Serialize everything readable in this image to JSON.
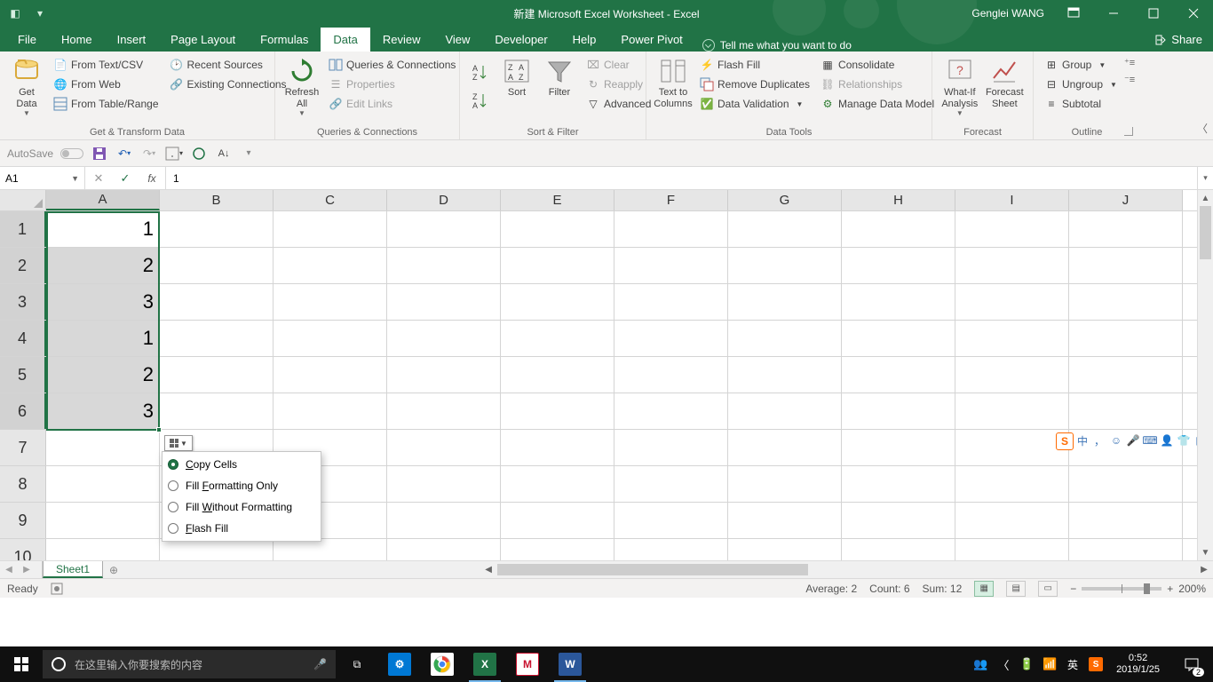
{
  "title": "新建 Microsoft Excel Worksheet  -  Excel",
  "user": "Genglei WANG",
  "tabs": [
    "File",
    "Home",
    "Insert",
    "Page Layout",
    "Formulas",
    "Data",
    "Review",
    "View",
    "Developer",
    "Help",
    "Power Pivot"
  ],
  "active_tab": "Data",
  "tellme": "Tell me what you want to do",
  "share": "Share",
  "ribbon": {
    "get_data": "Get\nData",
    "from_text": "From Text/CSV",
    "from_web": "From Web",
    "from_table": "From Table/Range",
    "recent": "Recent Sources",
    "existing": "Existing Connections",
    "g1": "Get & Transform Data",
    "refresh": "Refresh\nAll",
    "qc": "Queries & Connections",
    "props": "Properties",
    "edit_links": "Edit Links",
    "g2": "Queries & Connections",
    "sort": "Sort",
    "filter": "Filter",
    "clear": "Clear",
    "reapply": "Reapply",
    "advanced": "Advanced",
    "g3": "Sort & Filter",
    "ttc": "Text to\nColumns",
    "flash": "Flash Fill",
    "dup": "Remove Duplicates",
    "dvalid": "Data Validation",
    "consol": "Consolidate",
    "relat": "Relationships",
    "mdm": "Manage Data Model",
    "g4": "Data Tools",
    "whatif": "What-If\nAnalysis",
    "fsheet": "Forecast\nSheet",
    "g5": "Forecast",
    "group": "Group",
    "ungroup": "Ungroup",
    "subtotal": "Subtotal",
    "g6": "Outline"
  },
  "qat": {
    "autosave": "AutoSave"
  },
  "namebox": "A1",
  "formula": "1",
  "columns": [
    "A",
    "B",
    "C",
    "D",
    "E",
    "F",
    "G",
    "H",
    "I",
    "J"
  ],
  "rows": [
    {
      "n": "1",
      "a": "1"
    },
    {
      "n": "2",
      "a": "2"
    },
    {
      "n": "3",
      "a": "3"
    },
    {
      "n": "4",
      "a": "1"
    },
    {
      "n": "5",
      "a": "2"
    },
    {
      "n": "6",
      "a": "3"
    },
    {
      "n": "7",
      "a": ""
    },
    {
      "n": "8",
      "a": ""
    },
    {
      "n": "9",
      "a": ""
    },
    {
      "n": "10",
      "a": ""
    }
  ],
  "popup": {
    "copy": "opy Cells",
    "fmt": "ormatting Only",
    "wof": "ithout Formatting",
    "flash": "lash Fill",
    "pre_copy": "C",
    "pre_fmt": "Fill F",
    "pre_wof": "Fill W",
    "pre_flash": "F"
  },
  "sheet_tab": "Sheet1",
  "status": {
    "ready": "Ready",
    "avg_label": "Average:",
    "avg": "2",
    "cnt_label": "Count:",
    "cnt": "6",
    "sum_label": "Sum:",
    "sum": "12",
    "zoom": "200%"
  },
  "taskbar": {
    "search_placeholder": "在这里输入你要搜索的内容",
    "ime_lang": "英",
    "time": "0:52",
    "date": "2019/1/25",
    "notif_count": "2"
  },
  "sogou_logo": "S",
  "ime_cn": "中"
}
